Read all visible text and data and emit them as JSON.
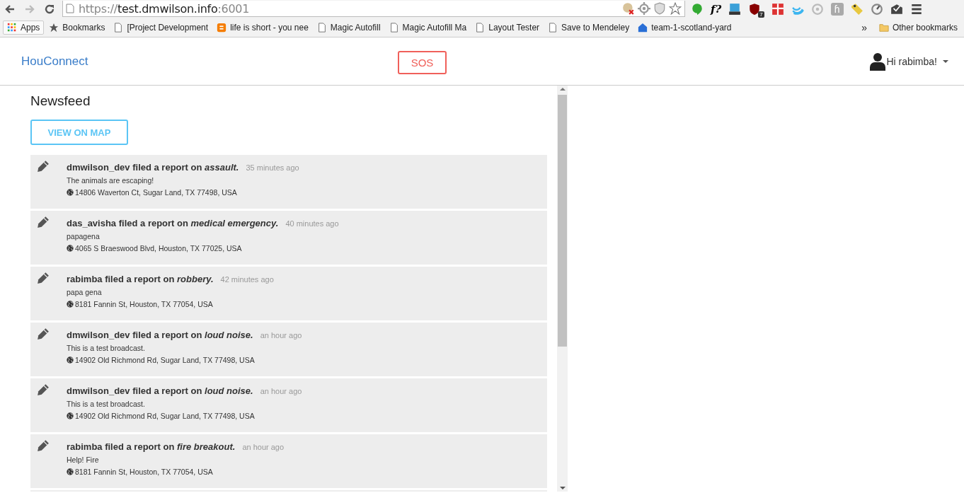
{
  "browser": {
    "url": {
      "scheme": "https://",
      "host": "test.dmwilson.info",
      "port": ":6001"
    },
    "extensions": [
      {
        "kind": "cookie"
      },
      {
        "kind": "target"
      },
      {
        "kind": "shield"
      },
      {
        "kind": "star"
      },
      {
        "kind": "hangouts"
      },
      {
        "kind": "text",
        "label": "f?"
      },
      {
        "kind": "keyboard"
      },
      {
        "kind": "ublock",
        "label": "7"
      },
      {
        "kind": "gift"
      },
      {
        "kind": "wave"
      },
      {
        "kind": "drop"
      },
      {
        "kind": "letter",
        "label": "ɦ"
      },
      {
        "kind": "tag"
      },
      {
        "kind": "gauge"
      },
      {
        "kind": "mail"
      },
      {
        "kind": "menu"
      }
    ],
    "bookmarks": [
      {
        "kind": "apps",
        "label": "Apps"
      },
      {
        "kind": "star",
        "label": "Bookmarks"
      },
      {
        "kind": "page",
        "label": "[Project Development"
      },
      {
        "kind": "blogger",
        "label": "life is short - you nee"
      },
      {
        "kind": "page",
        "label": "Magic Autofill"
      },
      {
        "kind": "page",
        "label": "Magic Autofill Ma"
      },
      {
        "kind": "page",
        "label": "Layout Tester"
      },
      {
        "kind": "page",
        "label": "Save to Mendeley"
      },
      {
        "kind": "house",
        "label": "team-1-scotland-yard"
      }
    ],
    "overflow": "»",
    "other_bookmarks": "Other bookmarks"
  },
  "header": {
    "brand": "HouConnect",
    "sos": "SOS",
    "greeting": "Hi rabimba!"
  },
  "newsfeed": {
    "title": "Newsfeed",
    "map_button": "VIEW ON MAP",
    "reports": [
      {
        "headline": "dmwilson_dev filed a report on *assault.*",
        "time": "35 minutes ago",
        "description": "The animals are escaping!",
        "address": "14806 Waverton Ct, Sugar Land, TX 77498, USA"
      },
      {
        "headline": "das_avisha filed a report on *medical emergency.*",
        "time": "40 minutes ago",
        "description": "papagena",
        "address": "4065 S Braeswood Blvd, Houston, TX 77025, USA"
      },
      {
        "headline": "rabimba filed a report on *robbery.*",
        "time": "42 minutes ago",
        "description": "papa gena",
        "address": "8181 Fannin St, Houston, TX 77054, USA"
      },
      {
        "headline": "dmwilson_dev filed a report on *loud noise.*",
        "time": "an hour ago",
        "description": "This is a test broadcast.",
        "address": "14902 Old Richmond Rd, Sugar Land, TX 77498, USA"
      },
      {
        "headline": "dmwilson_dev filed a report on *loud noise.*",
        "time": "an hour ago",
        "description": "This is a test broadcast.",
        "address": "14902 Old Richmond Rd, Sugar Land, TX 77498, USA"
      },
      {
        "headline": "rabimba filed a report on *fire breakout.*",
        "time": "an hour ago",
        "description": "Help! Fire",
        "address": "8181 Fannin St, Houston, TX 77054, USA"
      }
    ]
  }
}
